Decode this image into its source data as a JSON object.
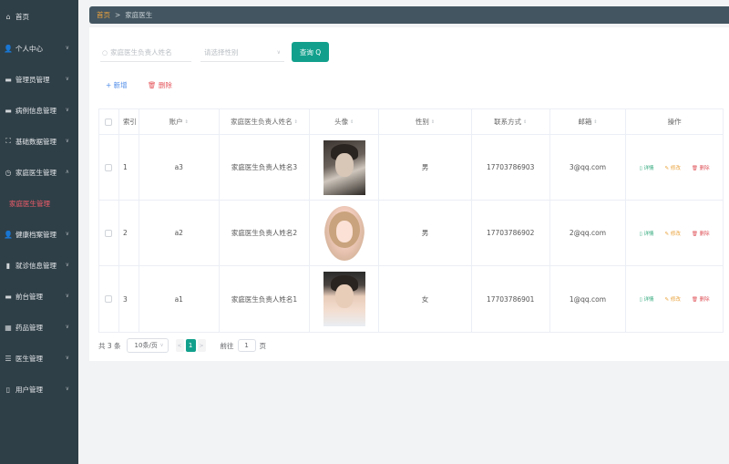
{
  "sidebar": {
    "items": [
      {
        "label": "首页",
        "icon": "home-icon",
        "glyph": "⌂"
      },
      {
        "label": "个人中心",
        "icon": "user-icon",
        "glyph": "👤"
      },
      {
        "label": "管理员管理",
        "icon": "folder-icon",
        "glyph": "▬"
      },
      {
        "label": "病例信息管理",
        "icon": "folder-icon",
        "glyph": "▬"
      },
      {
        "label": "基础数据管理",
        "icon": "expand-icon",
        "glyph": "⛶"
      },
      {
        "label": "家庭医生管理",
        "icon": "clock-icon",
        "glyph": "◷"
      },
      {
        "label": "家庭医生管理",
        "icon": "",
        "glyph": ""
      },
      {
        "label": "健康档案管理",
        "icon": "user-icon",
        "glyph": "👤"
      },
      {
        "label": "就诊信息管理",
        "icon": "bar-chart-icon",
        "glyph": "▮"
      },
      {
        "label": "前台管理",
        "icon": "folder-icon",
        "glyph": "▬"
      },
      {
        "label": "药品管理",
        "icon": "grid-icon",
        "glyph": "▦"
      },
      {
        "label": "医生管理",
        "icon": "sliders-icon",
        "glyph": "☰"
      },
      {
        "label": "用户管理",
        "icon": "mobile-icon",
        "glyph": "▯"
      }
    ]
  },
  "breadcrumb": {
    "home": "首页",
    "separator": ">",
    "current": "家庭医生"
  },
  "search": {
    "name_placeholder": "家庭医生负责人姓名",
    "gender_placeholder": "请选择性别",
    "query_label": "查询 Q"
  },
  "toolbar": {
    "add_label": "+ 新增",
    "delete_label": "🗑 删除"
  },
  "table": {
    "headers": [
      "",
      "索引",
      "账户",
      "家庭医生负责人姓名",
      "头像",
      "性别",
      "联系方式",
      "邮箱",
      "操作"
    ],
    "sort_glyph": "⇕",
    "rows": [
      {
        "index": "1",
        "account": "a3",
        "name": "家庭医生负责人姓名3",
        "gender": "男",
        "phone": "17703786903",
        "email": "3@qq.com"
      },
      {
        "index": "2",
        "account": "a2",
        "name": "家庭医生负责人姓名2",
        "gender": "男",
        "phone": "17703786902",
        "email": "2@qq.com"
      },
      {
        "index": "3",
        "account": "a1",
        "name": "家庭医生负责人姓名1",
        "gender": "女",
        "phone": "17703786901",
        "email": "1@qq.com"
      }
    ],
    "ops": {
      "detail": "▯ 详情",
      "edit": "✎ 修改",
      "remove": "🗑 删除"
    }
  },
  "pager": {
    "total": "共 3 条",
    "page_size": "10条/页",
    "prev": "<",
    "current_page": "1",
    "next": ">",
    "goto_label": "前往",
    "goto_value": "1",
    "page_suffix": "页"
  },
  "colors": {
    "sidebar": "#2f3f47",
    "accent": "#12a08c",
    "active_menu": "#f25c6a"
  }
}
